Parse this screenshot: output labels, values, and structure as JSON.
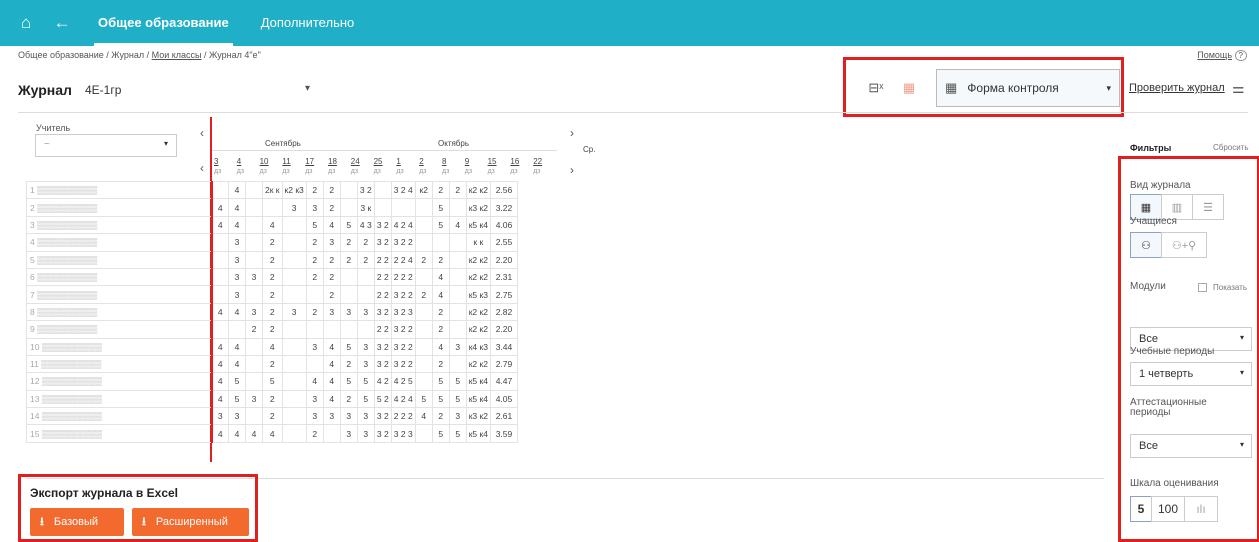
{
  "nav": {
    "tab_main": "Общее образование",
    "tab_extra": "Дополнительно",
    "home_icon": "home-icon",
    "back_icon": "arrow-left-icon"
  },
  "breadcrumb": {
    "part1": "Общее образование / Журнал / ",
    "part2": "Мои классы",
    "part3": " / Журнал 4\"е\""
  },
  "help": {
    "label": "Помощь",
    "icon": "?"
  },
  "journal": {
    "title": "Журнал",
    "group": "4Е-1гр"
  },
  "toolbar": {
    "form_select": "Форма контроля",
    "check_label": "Проверить журнал"
  },
  "teacher": {
    "label": "Учитель",
    "placeholder": "~"
  },
  "months": {
    "sep": "Сентябрь",
    "oct": "Октябрь"
  },
  "avg_label": "Ср.",
  "dates": [
    "3",
    "4",
    "10",
    "11",
    "17",
    "18",
    "24",
    "25",
    "1",
    "2",
    "8",
    "9",
    "15",
    "16",
    "22"
  ],
  "date_types": [
    "дз",
    "дз",
    "дз",
    "дз",
    "дз",
    "дз",
    "дз",
    "дз",
    "дз",
    "дз",
    "дз",
    "дз",
    "дз",
    "дз",
    "дз"
  ],
  "rows": [
    {
      "n": "1",
      "cells": [
        "",
        "4",
        "",
        "2к к",
        "к2 к3",
        "2",
        "2",
        "",
        "3 2",
        "",
        "3 2 4",
        "к2",
        "2",
        "2",
        "к2 к2"
      ],
      "avg": "2.56"
    },
    {
      "n": "2",
      "cells": [
        "4",
        "4",
        "",
        "",
        "3",
        "3",
        "2",
        "",
        "3 к",
        "",
        "",
        "",
        "5",
        "",
        "к3 к2"
      ],
      "avg": "3.22"
    },
    {
      "n": "3",
      "cells": [
        "4",
        "4",
        "",
        "4",
        "",
        "5",
        "4",
        "5",
        "4 3",
        "3 2",
        "4 2 4",
        "",
        "5",
        "4",
        "к5 к4"
      ],
      "avg": "4.06"
    },
    {
      "n": "4",
      "cells": [
        "",
        "3",
        "",
        "2",
        "",
        "2",
        "3",
        "2",
        "2",
        "3 2",
        "3 2 2",
        "",
        "",
        "",
        "к к"
      ],
      "avg": "2.55"
    },
    {
      "n": "5",
      "cells": [
        "",
        "3",
        "",
        "2",
        "",
        "2",
        "2",
        "2",
        "2",
        "2 2",
        "2 2 4",
        "2",
        "2",
        "",
        "к2 к2"
      ],
      "avg": "2.20"
    },
    {
      "n": "6",
      "cells": [
        "",
        "3",
        "3",
        "2",
        "",
        "2",
        "2",
        "",
        "",
        "2 2",
        "2 2 2",
        "",
        "4",
        "",
        "к2 к2"
      ],
      "avg": "2.31"
    },
    {
      "n": "7",
      "cells": [
        "",
        "3",
        "",
        "2",
        "",
        "",
        "2",
        "",
        "",
        "2 2",
        "3 2 2",
        "2",
        "4",
        "",
        "к5 к3"
      ],
      "avg": "2.75"
    },
    {
      "n": "8",
      "cells": [
        "4",
        "4",
        "3",
        "2",
        "3",
        "2",
        "3",
        "3",
        "3",
        "3 2",
        "3 2 3",
        "",
        "2",
        "",
        "к2 к2"
      ],
      "avg": "2.82"
    },
    {
      "n": "9",
      "cells": [
        "",
        "",
        "2",
        "2",
        "",
        "",
        "",
        "",
        "",
        "2 2",
        "3 2 2",
        "",
        "2",
        "",
        "к2 к2"
      ],
      "avg": "2.20"
    },
    {
      "n": "10",
      "cells": [
        "4",
        "4",
        "",
        "4",
        "",
        "3",
        "4",
        "5",
        "3",
        "3 2",
        "3 2 2",
        "",
        "4",
        "3",
        "к4 к3"
      ],
      "avg": "3.44"
    },
    {
      "n": "11",
      "cells": [
        "4",
        "4",
        "",
        "2",
        "",
        "",
        "4",
        "2",
        "3",
        "3 2",
        "3 2 2",
        "",
        "2",
        "",
        "к2 к2"
      ],
      "avg": "2.79"
    },
    {
      "n": "12",
      "cells": [
        "4",
        "5",
        "",
        "5",
        "",
        "4",
        "4",
        "5",
        "5",
        "4 2",
        "4 2 5",
        "",
        "5",
        "5",
        "к5 к4"
      ],
      "avg": "4.47"
    },
    {
      "n": "13",
      "cells": [
        "4",
        "5",
        "3",
        "2",
        "",
        "3",
        "4",
        "2",
        "5",
        "5 2",
        "4 2 4",
        "5",
        "5",
        "5",
        "к5 к4"
      ],
      "avg": "4.05"
    },
    {
      "n": "14",
      "cells": [
        "3",
        "3",
        "",
        "2",
        "",
        "3",
        "3",
        "3",
        "3",
        "3 2",
        "2 2 2",
        "4",
        "2",
        "3",
        "к3 к2"
      ],
      "avg": "2.61"
    },
    {
      "n": "15",
      "cells": [
        "4",
        "4",
        "4",
        "4",
        "",
        "2",
        "",
        "3",
        "3",
        "3 2",
        "3 2 3",
        "",
        "5",
        "5",
        "к5 к4"
      ],
      "avg": "3.59"
    }
  ],
  "export": {
    "title": "Экспорт журнала в Excel",
    "basic": "Базовый",
    "extended": "Расширенный"
  },
  "filters": {
    "title": "Фильтры",
    "reset": "Сбросить",
    "journal_type": "Вид журнала",
    "students": "Учащиеся",
    "modules": "Модули",
    "show": "Показать",
    "modules_value": "Все",
    "study_periods": "Учебные периоды",
    "study_period_value": "1 четверть",
    "attest_periods": "Аттестационные периоды",
    "attest_value": "Все",
    "scale": "Шкала оценивания",
    "scale_5": "5",
    "scale_100": "100"
  },
  "colors": {
    "header": "#1fb0c7",
    "accent": "#f26a2e",
    "highlight": "#e0201f"
  }
}
